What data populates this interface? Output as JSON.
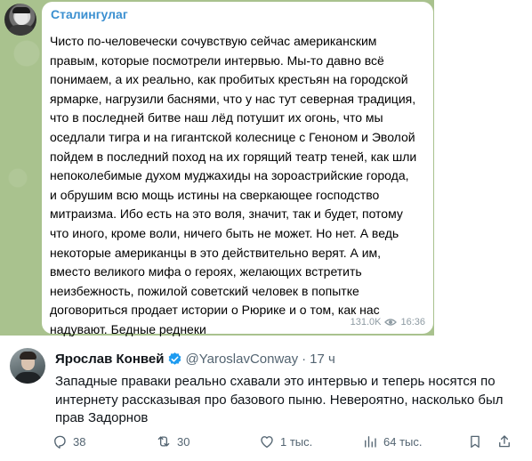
{
  "telegram": {
    "author": "Сталингулаг",
    "message_lines": [
      "Чисто по-человечески сочувствую сейчас американским",
      "правым, которые посмотрели интервью. Мы-то давно всё",
      "понимаем, а их реально, как пробитых крестьян на городской",
      "ярмарке, нагрузили баснями, что у нас тут северная традиция,",
      "что в последней битве наш лёд потушит их огонь, что мы",
      "оседлали тигра и на гигантской колеснице с Геноном и Эволой",
      "пойдем в последний поход на их горящий театр теней, как шли",
      "непоколебимые духом муджахиды на зороастрийские города,",
      "и обрушим всю мощь истины на сверкающее господство",
      "митраизма. Ибо есть на это воля, значит, так и будет, потому",
      "что иного, кроме воли, ничего быть не может. Но нет. А ведь",
      "некоторые американцы в это действительно верят. А им,",
      "вместо великого мифа о героях, желающих встретить",
      "неизбежность, пожилой советский человек в попытке",
      "договориться продает истории о Рюрике и о том, как нас",
      "надувают. Бедные реднеки"
    ],
    "views": "131.0K",
    "time": "16:36",
    "colors": {
      "author": "#3a8fd0",
      "background": "#a9c28e"
    }
  },
  "tweet": {
    "name": "Ярослав Конвей",
    "handle": "@YaroslavConway",
    "separator": "·",
    "time": "17 ч",
    "text_lines": [
      "Западные праваки реально схавали это интервью и теперь носятся по",
      "интернету рассказывая про базового пыню. Невероятно, насколько был",
      "прав Задорнов"
    ],
    "actions": {
      "replies": "38",
      "retweets": "30",
      "likes": "1 тыс.",
      "views": "64 тыс."
    },
    "colors": {
      "verified": "#1d9bf0",
      "muted": "#536471"
    }
  }
}
